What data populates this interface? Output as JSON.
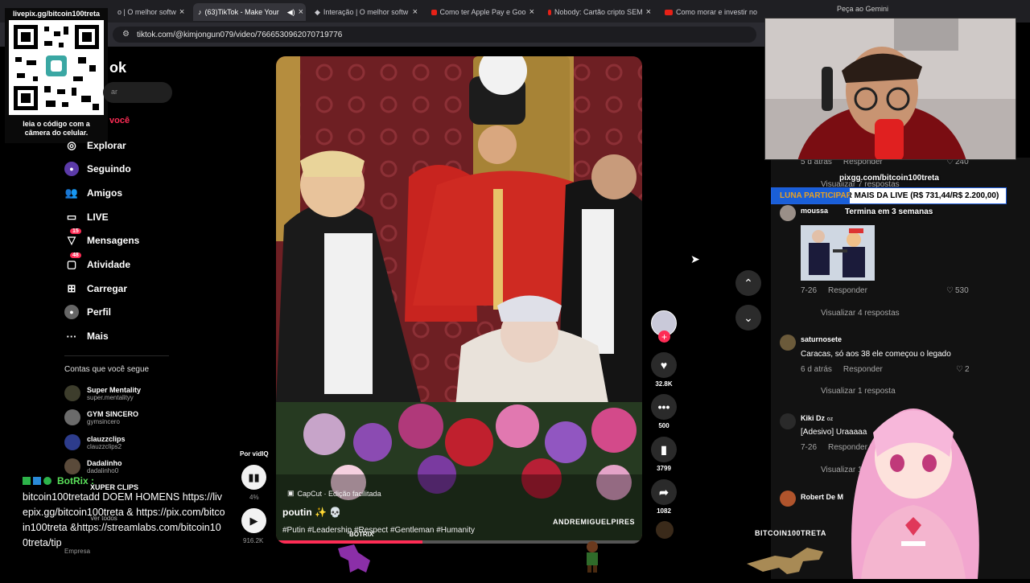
{
  "browser": {
    "tabs": [
      {
        "label": "o | O melhor softw",
        "type": "web"
      },
      {
        "label": "(63)TikTok - Make Your",
        "type": "tiktok",
        "active": true
      },
      {
        "label": "Interação | O melhor softw",
        "type": "web"
      },
      {
        "label": "Como ter Apple Pay e Goo",
        "type": "youtube"
      },
      {
        "label": "Nobody: Cartão cripto SEM",
        "type": "youtube"
      },
      {
        "label": "Como morar e investir no",
        "type": "youtube"
      }
    ],
    "url": "tiktok.com/@kimjongun079/video/7666530962070719776",
    "gemini_label": "Peça ao Gemini"
  },
  "overlay": {
    "qr_header": "livepix.gg/bitcoin100treta",
    "qr_caption": "leia o código com a câmera do celular.",
    "pix_url": "pixgg.com/bitcoin100treta",
    "goal_label": "LUNA PARTICIPAR MAIS DA LIVE (R$ 731,44/R$ 2.200,00)",
    "goal_progress": 0.3325,
    "goal_ends": "Termina em 3 semanas",
    "chat_user": "BotRix :",
    "chat_message": "bitcoin100tretadd DOEM HOMENS https://livepix.gg/bitcoin100treta & https://pix.com/bitcoin100treta &https://streamlabs.com/bitcoin100treta/tip",
    "watermark_right": "BITCOIN100TRETA",
    "watermark_left": "BOTRIX"
  },
  "sidebar": {
    "logo": "ok",
    "search_placeholder": "ar",
    "items": [
      {
        "label": "você",
        "icon": "home-icon"
      },
      {
        "label": "Explorar",
        "icon": "compass-icon"
      },
      {
        "label": "Seguindo",
        "icon": "following-icon"
      },
      {
        "label": "Amigos",
        "icon": "friends-icon"
      },
      {
        "label": "LIVE",
        "icon": "live-icon"
      },
      {
        "label": "Mensagens",
        "icon": "message-icon",
        "badge": "15"
      },
      {
        "label": "Atividade",
        "icon": "activity-icon",
        "badge": "48"
      },
      {
        "label": "Carregar",
        "icon": "upload-icon"
      },
      {
        "label": "Perfil",
        "icon": "profile-icon"
      },
      {
        "label": "Mais",
        "icon": "more-icon"
      }
    ],
    "following_title": "Contas que você segue",
    "accounts": [
      {
        "name": "Super Mentality",
        "handle": "super.mentalityy"
      },
      {
        "name": "GYM SINCERO",
        "handle": "gymsincero"
      },
      {
        "name": "clauzzclips",
        "handle": "clauzzclips2"
      },
      {
        "name": "Dadalinho",
        "handle": "dadalinho0"
      },
      {
        "name": "XUPER CLIPS",
        "handle": ""
      }
    ],
    "see_all": "Ver todos",
    "company": "Empresa"
  },
  "player": {
    "por_vidiq": "Por vidIQ",
    "vidiq_pct": "4%",
    "vidiq_views": "916.2K",
    "capcut": "CapCut · Edição facilitada",
    "caption": "poutin ✨ 💀",
    "hashtags": "#Putin #Leadership #Respect #Gentleman #Humanity",
    "watermark": "ANDREMIGUELPIRES",
    "likes": "32.8K",
    "comments": "500",
    "saves": "3799",
    "shares": "1082"
  },
  "comments": {
    "top_meta": "5 d atrás",
    "top_reply": "Responder",
    "top_likes": "240",
    "view_7": "Visualizar 7 respostas",
    "items": [
      {
        "user": "moussa",
        "text": "",
        "time": "7-26",
        "reply": "Responder",
        "likes": "530",
        "replies": "Visualizar 4 respostas"
      },
      {
        "user": "saturnosete",
        "text": "Caracas, só aos 38 ele começou o legado",
        "time": "6 d atrás",
        "reply": "Responder",
        "likes": "2",
        "replies": "Visualizar 1 resposta"
      },
      {
        "user": "Kiki Dz",
        "tag": "oz",
        "text": "[Adesivo] Uraaaaa",
        "time": "7-26",
        "reply": "Responder",
        "likes": "",
        "replies": "Visualizar 13"
      },
      {
        "user": "Robert De M",
        "text": "",
        "time": "",
        "reply": "",
        "likes": "",
        "replies": ""
      }
    ]
  }
}
